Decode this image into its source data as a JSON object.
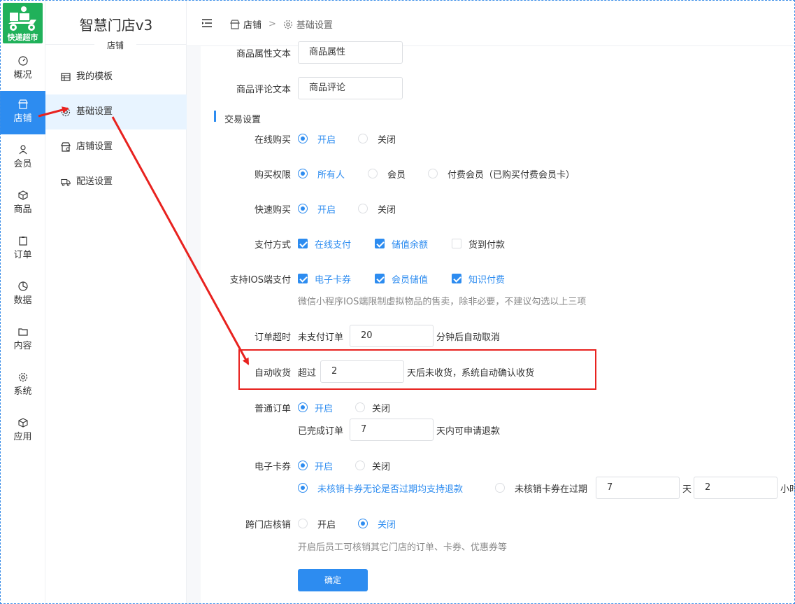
{
  "logo": {
    "text": "快递超市"
  },
  "rail": {
    "items": [
      {
        "label": "概况",
        "icon": "gauge-icon"
      },
      {
        "label": "店铺",
        "icon": "store-icon"
      },
      {
        "label": "会员",
        "icon": "user-icon"
      },
      {
        "label": "商品",
        "icon": "box-icon"
      },
      {
        "label": "订单",
        "icon": "clipboard-icon"
      },
      {
        "label": "数据",
        "icon": "pie-icon"
      },
      {
        "label": "内容",
        "icon": "folder-icon"
      },
      {
        "label": "系统",
        "icon": "gear-icon"
      },
      {
        "label": "应用",
        "icon": "cube-icon"
      }
    ]
  },
  "submenu": {
    "brand": "智慧门店v3",
    "title": "店铺",
    "items": [
      {
        "label": "我的模板"
      },
      {
        "label": "基础设置"
      },
      {
        "label": "店铺设置"
      },
      {
        "label": "配送设置"
      }
    ]
  },
  "breadcrumb": {
    "parent": "店铺",
    "sep": ">",
    "current": "基础设置"
  },
  "form": {
    "attr_text": {
      "label": "商品属性文本",
      "value": "商品属性"
    },
    "review_text": {
      "label": "商品评论文本",
      "value": "商品评论"
    },
    "section_title": "交易设置",
    "online_buy": {
      "label": "在线购买",
      "opt_on": "开启",
      "opt_off": "关闭"
    },
    "buy_permission": {
      "label": "购买权限",
      "opt_all": "所有人",
      "opt_member": "会员",
      "opt_paid": "付费会员（已购买付费会员卡）"
    },
    "quick_buy": {
      "label": "快速购买",
      "opt_on": "开启",
      "opt_off": "关闭"
    },
    "pay_method": {
      "label": "支付方式",
      "opt_online": "在线支付",
      "opt_balance": "储值余额",
      "opt_cod": "货到付款"
    },
    "ios_pay": {
      "label": "支持IOS端支付",
      "opt_ecard": "电子卡券",
      "opt_member_stored": "会员储值",
      "opt_knowledge": "知识付费",
      "hint": "微信小程序IOS端限制虚拟物品的售卖，除非必要，不建议勾选以上三项"
    },
    "order_timeout": {
      "label": "订单超时",
      "prefix": "未支付订单",
      "value": "20",
      "suffix": "分钟后自动取消"
    },
    "auto_receive": {
      "label": "自动收货",
      "prefix": "超过",
      "value": "2",
      "suffix": "天后未收货，系统自动确认收货"
    },
    "normal_order": {
      "label": "普通订单",
      "opt_on": "开启",
      "opt_off": "关闭",
      "prefix": "已完成订单",
      "value": "7",
      "suffix": "天内可申请退款"
    },
    "ecard": {
      "label": "电子卡券",
      "opt_on": "开启",
      "opt_off": "关闭",
      "opt_refund_any": "未核销卡券无论是否过期均支持退款",
      "opt_refund_expire": "未核销卡券在过期",
      "days_value": "7",
      "days_unit": "天",
      "hours_value": "2",
      "hours_unit": "小时"
    },
    "cross_store": {
      "label": "跨门店核销",
      "opt_on": "开启",
      "opt_off": "关闭",
      "hint": "开启后员工可核销其它门店的订单、卡券、优惠券等"
    },
    "submit": "确定"
  },
  "colors": {
    "accent": "#2d8cf0",
    "annotation": "#e8221f",
    "logo_bg": "#20b15a"
  }
}
